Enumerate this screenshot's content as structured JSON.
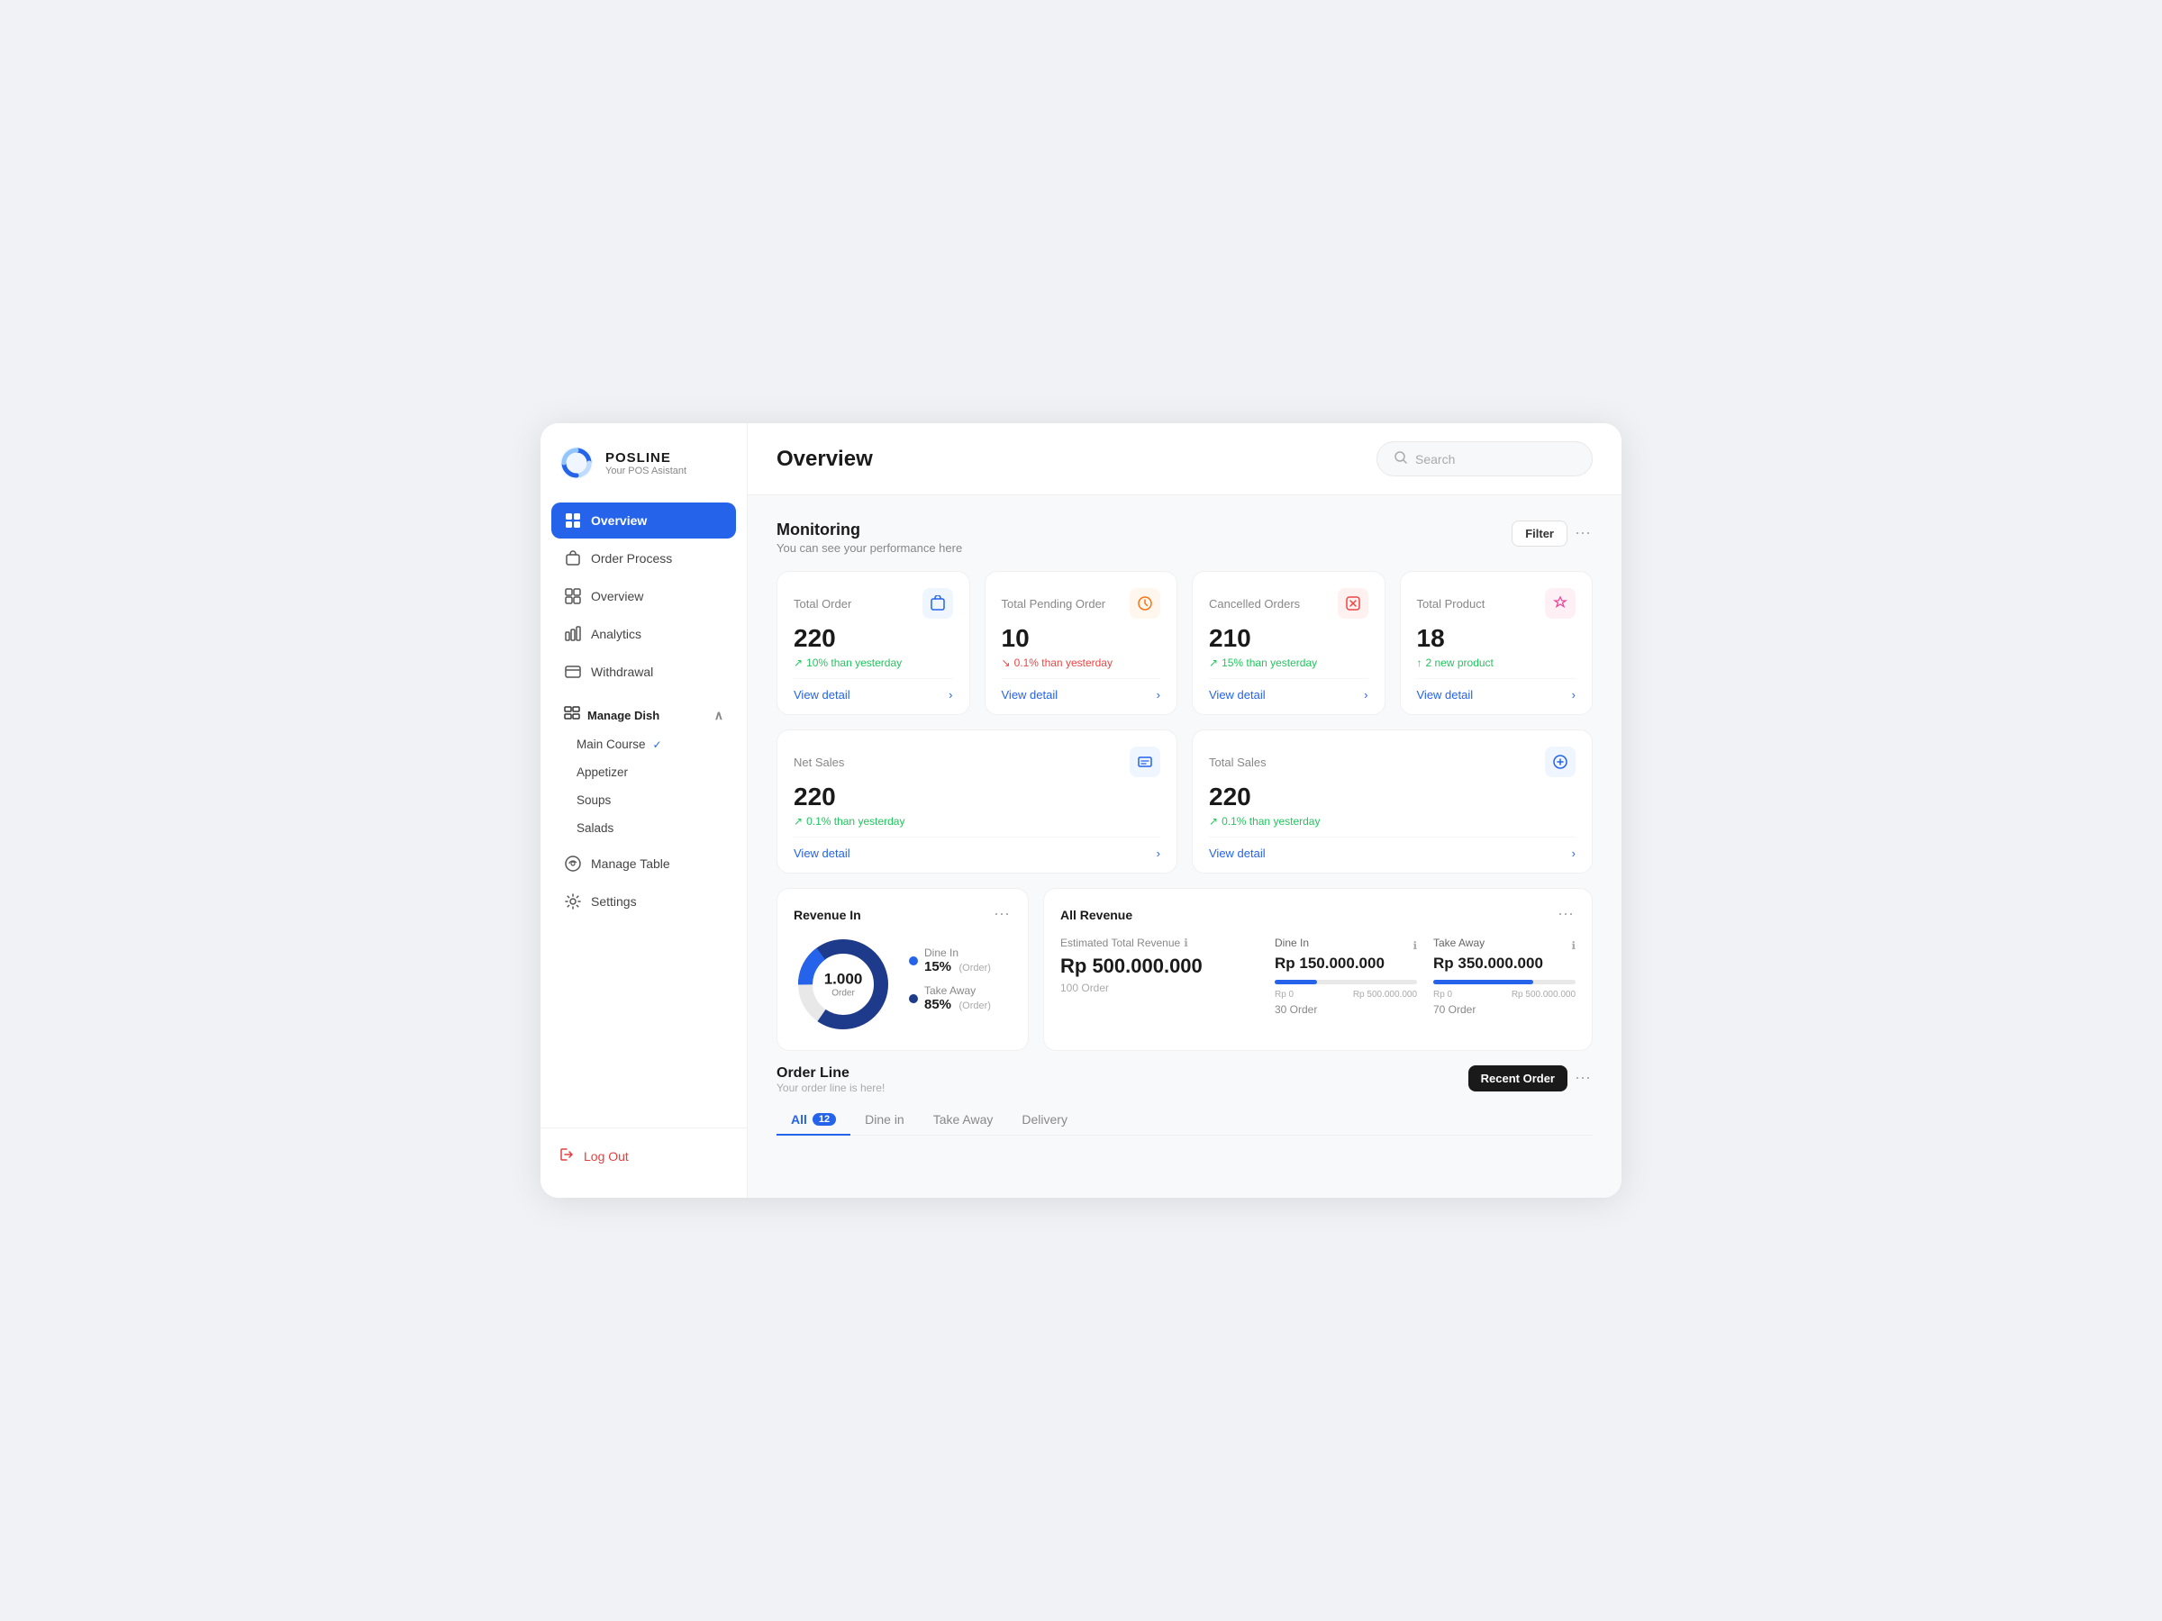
{
  "app": {
    "name": "POSLINE",
    "subtitle": "Your POS Asistant"
  },
  "header": {
    "title": "Overview",
    "search_placeholder": "Search"
  },
  "sidebar": {
    "nav_items": [
      {
        "id": "overview",
        "label": "Overview",
        "active": true
      },
      {
        "id": "order-process",
        "label": "Order Process",
        "active": false
      },
      {
        "id": "overview2",
        "label": "Overview",
        "active": false
      },
      {
        "id": "analytics",
        "label": "Analytics",
        "active": false
      },
      {
        "id": "withdrawal",
        "label": "Withdrawal",
        "active": false
      }
    ],
    "manage_dish": {
      "label": "Manage Dish",
      "submenu": [
        {
          "id": "main-course",
          "label": "Main Course",
          "checked": true
        },
        {
          "id": "appetizer",
          "label": "Appetizer",
          "checked": false
        },
        {
          "id": "soups",
          "label": "Soups",
          "checked": false
        },
        {
          "id": "salads",
          "label": "Salads",
          "checked": false
        }
      ]
    },
    "manage_table": "Manage Table",
    "settings": "Settings",
    "logout": "Log Out"
  },
  "monitoring": {
    "title": "Monitoring",
    "subtitle": "You can see your performance here",
    "filter_label": "Filter",
    "stats": [
      {
        "id": "total-order",
        "label": "Total Order",
        "value": "220",
        "change": "10% than yesterday",
        "change_dir": "up",
        "detail_link": "View detail",
        "icon_type": "blue"
      },
      {
        "id": "total-pending-order",
        "label": "Total Pending Order",
        "value": "10",
        "change": "0.1% than yesterday",
        "change_dir": "down",
        "detail_link": "View detail",
        "icon_type": "orange"
      },
      {
        "id": "cancelled-orders",
        "label": "Cancelled Orders",
        "value": "210",
        "change": "15% than yesterday",
        "change_dir": "up",
        "detail_link": "View detail",
        "icon_type": "red"
      },
      {
        "id": "total-product",
        "label": "Total Product",
        "value": "18",
        "change": "2 new product",
        "change_dir": "up",
        "detail_link": "View detail",
        "icon_type": "pink"
      }
    ],
    "sales": [
      {
        "id": "net-sales",
        "label": "Net Sales",
        "value": "220",
        "change": "0.1% than yesterday",
        "change_dir": "up",
        "detail_link": "View detail"
      },
      {
        "id": "total-sales",
        "label": "Total Sales",
        "value": "220",
        "change": "0.1% than yesterday",
        "change_dir": "up",
        "detail_link": "View detail"
      }
    ]
  },
  "revenue_in": {
    "title": "Revenue In",
    "donut": {
      "total_value": "1.000",
      "total_label": "Order",
      "segments": [
        {
          "label": "Dine In",
          "pct": 15,
          "pct_display": "15%",
          "sub": "(Order)",
          "color": "#2563eb",
          "offset_pct": 0
        },
        {
          "label": "Take Away",
          "pct": 85,
          "pct_display": "85%",
          "sub": "(Order)",
          "color": "#1e3a8a",
          "offset_pct": 15
        }
      ]
    }
  },
  "all_revenue": {
    "title": "All Revenue",
    "estimated_label": "Estimated Total Revenue",
    "estimated_value": "Rp 500.000.000",
    "estimated_orders": "100 Order",
    "info_icon": "ℹ",
    "segments": [
      {
        "id": "dine-in",
        "label": "Dine In",
        "amount": "Rp 150.000.000",
        "progress_pct": 30,
        "min_label": "Rp 0",
        "max_label": "Rp 500.000.000",
        "orders": "30 Order",
        "color": "#2563eb"
      },
      {
        "id": "take-away",
        "label": "Take Away",
        "amount": "Rp 350.000.000",
        "progress_pct": 70,
        "min_label": "Rp 0",
        "max_label": "Rp 500.000.000",
        "orders": "70 Order",
        "color": "#2563eb"
      }
    ]
  },
  "order_line": {
    "title": "Order Line",
    "subtitle": "Your order line is here!",
    "recent_order_label": "Recent Order",
    "tabs": [
      {
        "id": "all",
        "label": "All",
        "badge": "12",
        "active": true
      },
      {
        "id": "dine-in",
        "label": "Dine in",
        "badge": null,
        "active": false
      },
      {
        "id": "take-away",
        "label": "Take Away",
        "badge": null,
        "active": false
      },
      {
        "id": "delivery",
        "label": "Delivery",
        "badge": null,
        "active": false
      }
    ]
  },
  "colors": {
    "primary": "#2563eb",
    "danger": "#ef4444",
    "success": "#22c55e",
    "warning": "#f97316",
    "text_primary": "#1a1a1a",
    "text_secondary": "#888888"
  }
}
